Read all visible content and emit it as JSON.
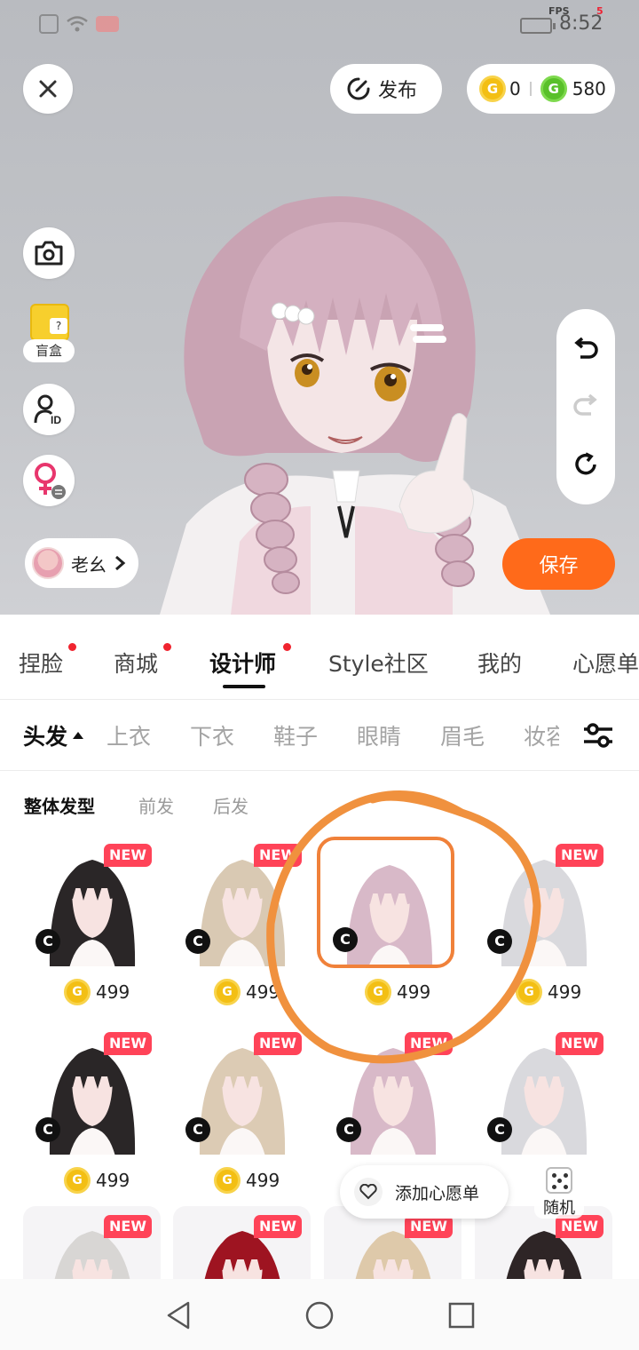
{
  "status_bar": {
    "fps_label": "FPS",
    "fps_value": "5",
    "time": "8:52"
  },
  "top": {
    "publish_label": "发布",
    "gold_coins": "0",
    "green_coins": "580",
    "gold_coin_glyph": "G",
    "green_coin_glyph": "G"
  },
  "left_tools": {
    "blindbox_label": "盲盒",
    "nickname": "老幺"
  },
  "save_label": "保存",
  "main_tabs": [
    {
      "label": "捏脸",
      "dot": true
    },
    {
      "label": "商城",
      "dot": true
    },
    {
      "label": "设计师",
      "dot": true,
      "active": true
    },
    {
      "label": "Style社区",
      "dot": false
    },
    {
      "label": "我的",
      "dot": false
    },
    {
      "label": "心愿单",
      "dot": false
    }
  ],
  "sub_tabs": [
    "头发",
    "上衣",
    "下衣",
    "鞋子",
    "眼睛",
    "眉毛",
    "妆容"
  ],
  "hair_tabs": [
    "整体发型",
    "前发",
    "后发"
  ],
  "items": [
    {
      "hair_color": "#2a2627",
      "new": "NEW",
      "badge": "C",
      "price": "499"
    },
    {
      "hair_color": "#d9c9b3",
      "new": "NEW",
      "badge": "C",
      "price": "499"
    },
    {
      "hair_color": "#d8b9c8",
      "new": "",
      "badge": "C",
      "price": "499",
      "selected": true
    },
    {
      "hair_color": "#d9d9dd",
      "new": "NEW",
      "badge": "C",
      "price": "499"
    },
    {
      "hair_color": "#2a2627",
      "new": "NEW",
      "badge": "C",
      "price": "499"
    },
    {
      "hair_color": "#dccbb4",
      "new": "NEW",
      "badge": "C",
      "price": "499"
    },
    {
      "hair_color": "#d8b9c8",
      "new": "NEW",
      "badge": "C",
      "price": ""
    },
    {
      "hair_color": "#d9d9dd",
      "new": "NEW",
      "badge": "C",
      "price": ""
    },
    {
      "hair_color": "#d8d6d4",
      "new": "NEW",
      "badge": "",
      "price": ""
    },
    {
      "hair_color": "#9e1421",
      "new": "NEW",
      "badge": "",
      "price": ""
    },
    {
      "hair_color": "#dec9aa",
      "new": "NEW",
      "badge": "",
      "price": ""
    },
    {
      "hair_color": "#2e2526",
      "new": "NEW",
      "badge": "",
      "price": ""
    }
  ],
  "wishlist_label": "添加心愿单",
  "random_label": "随机",
  "colors": {
    "accent": "#ff6a1a",
    "new_badge": "#ff4358",
    "selection": "#f0813a",
    "scribble": "#f0913e"
  }
}
